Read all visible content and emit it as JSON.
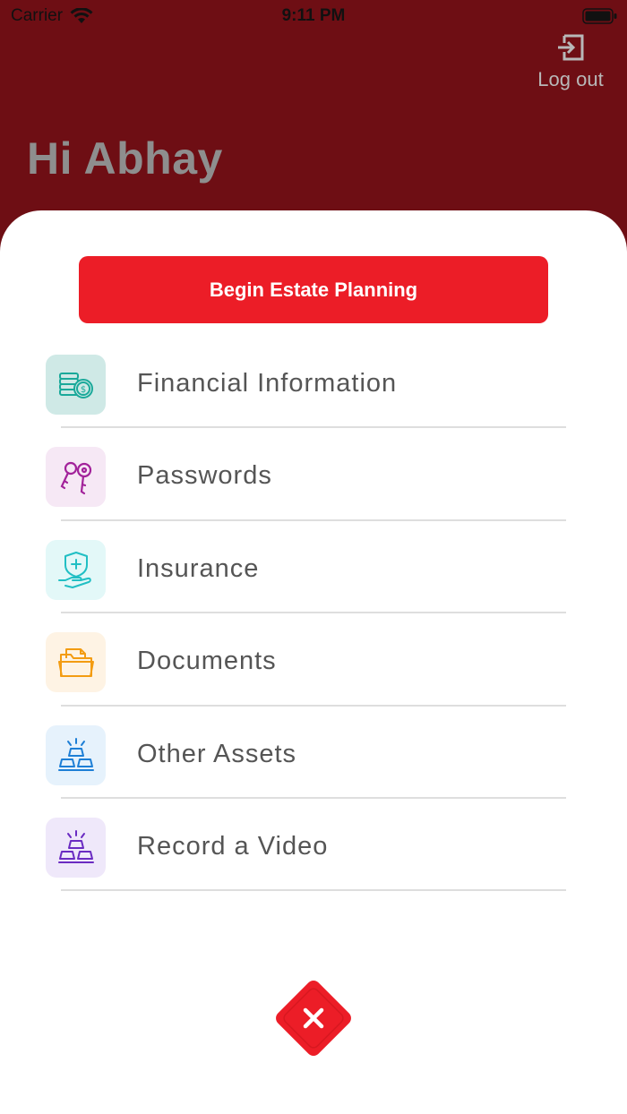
{
  "status_bar": {
    "carrier": "Carrier",
    "time": "9:11 PM"
  },
  "header": {
    "logout_label": "Log out",
    "greeting": "Hi Abhay"
  },
  "primary_action": {
    "label": "Begin Estate Planning"
  },
  "menu": {
    "items": [
      {
        "label": "Financial Information",
        "icon": "coins-icon",
        "color": "#1aa99a",
        "bg": "#cfe9e6"
      },
      {
        "label": "Passwords",
        "icon": "keys-icon",
        "color": "#a2229a",
        "bg": "#f6e8f5"
      },
      {
        "label": "Insurance",
        "icon": "insurance-icon",
        "color": "#21bfc4",
        "bg": "#e3f8f8"
      },
      {
        "label": "Documents",
        "icon": "folder-icon",
        "color": "#f39c12",
        "bg": "#fef3e4"
      },
      {
        "label": "Other Assets",
        "icon": "gold-bars-icon",
        "color": "#1e7fd6",
        "bg": "#e6f2fc"
      },
      {
        "label": "Record a Video",
        "icon": "gold-bars-icon",
        "color": "#6a2bc2",
        "bg": "#efe8fa"
      }
    ]
  },
  "colors": {
    "header_bg": "#6e0e14",
    "accent": "#ec1d27"
  }
}
